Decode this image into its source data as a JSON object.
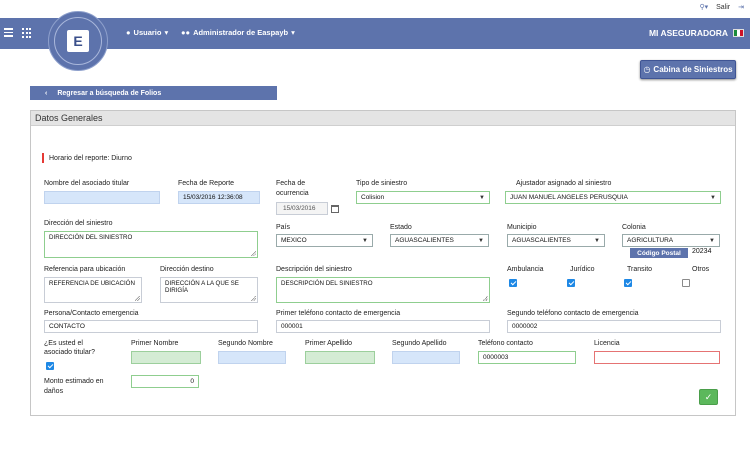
{
  "topbar": {
    "exit_label": "Salir"
  },
  "navbar": {
    "user_menu": "Usuario",
    "admin_menu": "Administrador de Easpayb",
    "brand": "MI ASEGURADORA",
    "logo_letter": "E",
    "colors": {
      "bar": "#5d73ac"
    }
  },
  "actions": {
    "cabina": "Cabina de Siniestros",
    "regresar": "Regresar a búsqueda de Folios",
    "ok_glyph": "✓"
  },
  "panel": {
    "title": "Datos Generales"
  },
  "horario": "Horario del reporte: Diurno",
  "form": {
    "nombre_asociado": {
      "label": "Nombre del asociado titular",
      "value": ""
    },
    "fecha_reporte": {
      "label": "Fecha de Reporte",
      "value": "15/03/2016 12:36:08"
    },
    "fecha_ocurrencia": {
      "label1": "Fecha de",
      "label2": "ocurrencia",
      "value": "15/03/2016"
    },
    "tipo_siniestro": {
      "label": "Tipo de siniestro",
      "value": "Colision"
    },
    "ajustador": {
      "label": "Ajustador asignado al siniestro",
      "value": "JUAN MANUEL ANGELES PERUSQUIA"
    },
    "direccion_siniestro": {
      "label": "Dirección del siniestro",
      "value": "DIRECCIÓN DEL SINIESTRO"
    },
    "pais": {
      "label": "País",
      "value": "MEXICO"
    },
    "estado": {
      "label": "Estado",
      "value": "AGUASCALIENTES"
    },
    "municipio": {
      "label": "Municipio",
      "value": "AGUASCALIENTES"
    },
    "colonia": {
      "label": "Colonia",
      "value": "AGRICULTURA"
    },
    "codigo_postal": {
      "label": "Código Postal",
      "value": "20234"
    },
    "referencia": {
      "label": "Referencia para ubicación",
      "value": "REFERENCIA DE UBICACIÓN"
    },
    "direccion_destino": {
      "label": "Dirección destino",
      "value": "DIRECCIÓN A LA QUE SE DIRIGÍA"
    },
    "descripcion": {
      "label": "Descripción del siniestro",
      "value": "DESCRIPCIÓN DEL SINIESTRO"
    },
    "servicios": [
      {
        "label": "Ambulancia",
        "checked": true
      },
      {
        "label": "Jurídico",
        "checked": true
      },
      {
        "label": "Transito",
        "checked": true
      },
      {
        "label": "Otros",
        "checked": false
      }
    ],
    "persona_contacto": {
      "label": "Persona/Contacto emergencia",
      "value": "CONTACTO"
    },
    "primer_telefono": {
      "label": "Primer teléfono contacto de emergencia",
      "value": "000001"
    },
    "segundo_telefono": {
      "label": "Segundo teléfono contacto de emergencia",
      "value": "0000002"
    },
    "es_titular": {
      "label1": "¿Es usted el",
      "label2": "asociado titular?",
      "checked": true
    },
    "primer_nombre": {
      "label": "Primer Nombre",
      "value": ""
    },
    "segundo_nombre": {
      "label": "Segundo Nombre",
      "value": ""
    },
    "primer_apellido": {
      "label": "Primer Apellido",
      "value": ""
    },
    "segundo_apellido": {
      "label": "Segundo Apellido",
      "value": ""
    },
    "telefono_contacto": {
      "label": "Teléfono contacto",
      "value": "0000003"
    },
    "licencia": {
      "label": "Licencia",
      "value": ""
    },
    "monto": {
      "label1": "Monto estimado en",
      "label2": "daños",
      "value": "0"
    }
  }
}
